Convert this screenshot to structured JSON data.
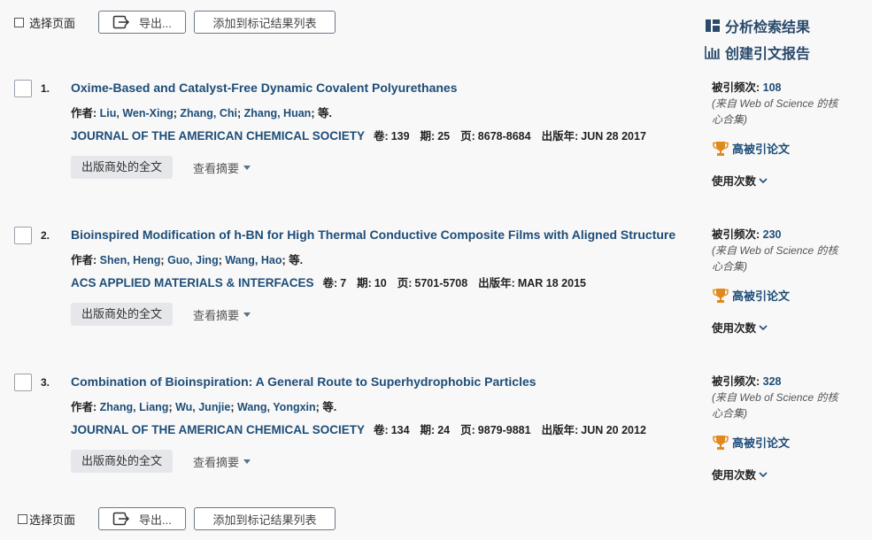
{
  "toolbar": {
    "select_page": "选择页面",
    "export_label": "导出...",
    "add_marked_label": "添加到标记结果列表"
  },
  "side_links": {
    "analyze": "分析检索结果",
    "citation_report": "创建引文报告"
  },
  "labels": {
    "authors_prefix": "作者:",
    "etc": "等.",
    "volume": "卷:",
    "issue": "期:",
    "pages": "页:",
    "published": "出版年:",
    "full_text": "出版商处的全文",
    "view_abstract": "查看摘要",
    "times_cited": "被引频次:",
    "source_note": "(来自 Web of Science 的核心合集)",
    "highly_cited": "高被引论文",
    "usage_count": "使用次数"
  },
  "records": [
    {
      "num": "1.",
      "title": "Oxime-Based and Catalyst-Free Dynamic Covalent Polyurethanes",
      "authors": [
        "Liu, Wen-Xing",
        "Zhang, Chi",
        "Zhang, Huan"
      ],
      "journal": "JOURNAL OF THE AMERICAN CHEMICAL SOCIETY",
      "volume": "139",
      "issue": "25",
      "pages": "8678-8684",
      "date": "JUN 28 2017",
      "times_cited": "108"
    },
    {
      "num": "2.",
      "title": "Bioinspired Modification of h-BN for High Thermal Conductive Composite Films with Aligned Structure",
      "authors": [
        "Shen, Heng",
        "Guo, Jing",
        "Wang, Hao"
      ],
      "journal": "ACS APPLIED MATERIALS & INTERFACES",
      "volume": "7",
      "issue": "10",
      "pages": "5701-5708",
      "date": "MAR 18 2015",
      "times_cited": "230"
    },
    {
      "num": "3.",
      "title": "Combination of Bioinspiration: A General Route to Superhydrophobic Particles",
      "authors": [
        "Zhang, Liang",
        "Wu, Junjie",
        "Wang, Yongxin"
      ],
      "journal": "JOURNAL OF THE AMERICAN CHEMICAL SOCIETY",
      "volume": "134",
      "issue": "24",
      "pages": "9879-9881",
      "date": "JUN 20 2012",
      "times_cited": "328"
    }
  ],
  "colors": {
    "link": "#1e4d78",
    "trophy": "#e08a1e",
    "background": "#f8f8f8"
  },
  "icons": {
    "export": "export-icon",
    "analyze": "bar-analyze-icon",
    "citation_report": "bar-chart-icon",
    "highly_cited": "trophy-icon",
    "usage": "chevron-down-icon"
  }
}
